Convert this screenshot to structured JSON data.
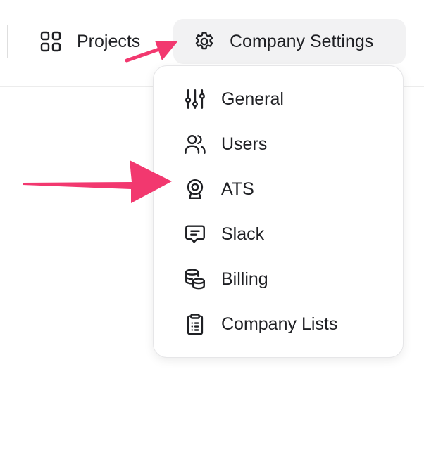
{
  "nav": {
    "projects": {
      "label": "Projects",
      "icon": "grid-icon"
    },
    "company_settings": {
      "label": "Company Settings",
      "icon": "gear-icon"
    }
  },
  "menu": {
    "items": [
      {
        "label": "General",
        "icon": "sliders-icon"
      },
      {
        "label": "Users",
        "icon": "users-icon"
      },
      {
        "label": "ATS",
        "icon": "webcam-icon"
      },
      {
        "label": "Slack",
        "icon": "message-icon"
      },
      {
        "label": "Billing",
        "icon": "coins-icon"
      },
      {
        "label": "Company Lists",
        "icon": "clipboard-list-icon"
      }
    ]
  },
  "colors": {
    "annotation_arrow": "#f2386f",
    "active_nav_bg": "#f2f2f3",
    "text": "#1f2024"
  }
}
